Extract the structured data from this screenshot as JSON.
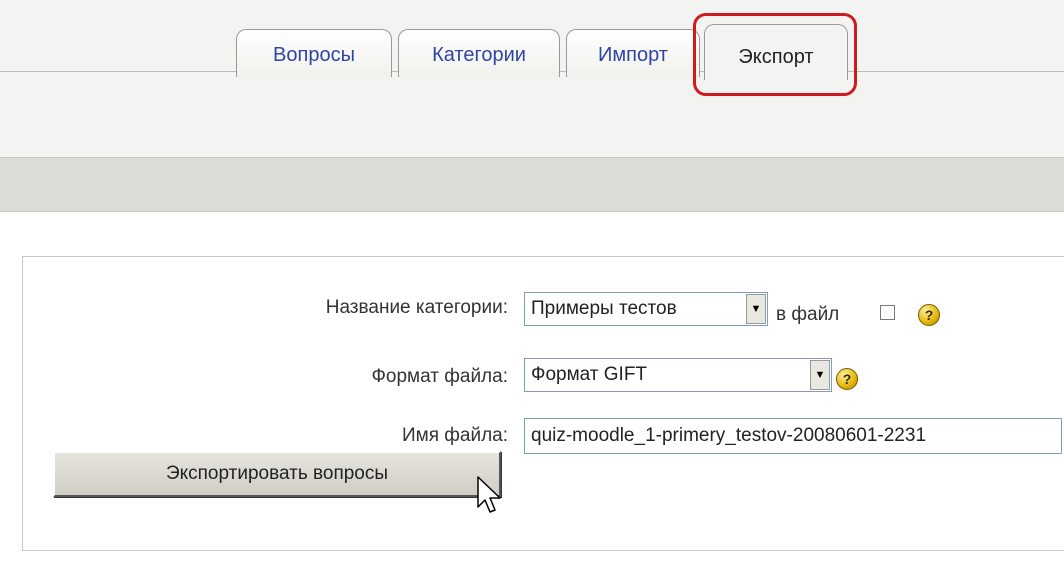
{
  "tabs": [
    {
      "label": "Вопросы",
      "active": false
    },
    {
      "label": "Категории",
      "active": false
    },
    {
      "label": "Импорт",
      "active": false
    },
    {
      "label": "Экспорт",
      "active": true
    }
  ],
  "form": {
    "category": {
      "label": "Название категории:",
      "selected": "Примеры тестов",
      "to_file_label": "в файл",
      "to_file_checked": false
    },
    "format": {
      "label": "Формат файла:",
      "selected": "Формат GIFT"
    },
    "filename": {
      "label": "Имя файла:",
      "value": "quiz-moodle_1-primery_testov-20080601-2231"
    },
    "submit_label": "Экспортировать вопросы"
  },
  "icons": {
    "help": "help-icon",
    "dropdown": "chevron-down-icon",
    "cursor": "mouse-pointer-icon"
  },
  "colors": {
    "tab_link": "#2f44a8",
    "highlight": "#d01a1e",
    "gray_bar": "#dcdcd6"
  }
}
